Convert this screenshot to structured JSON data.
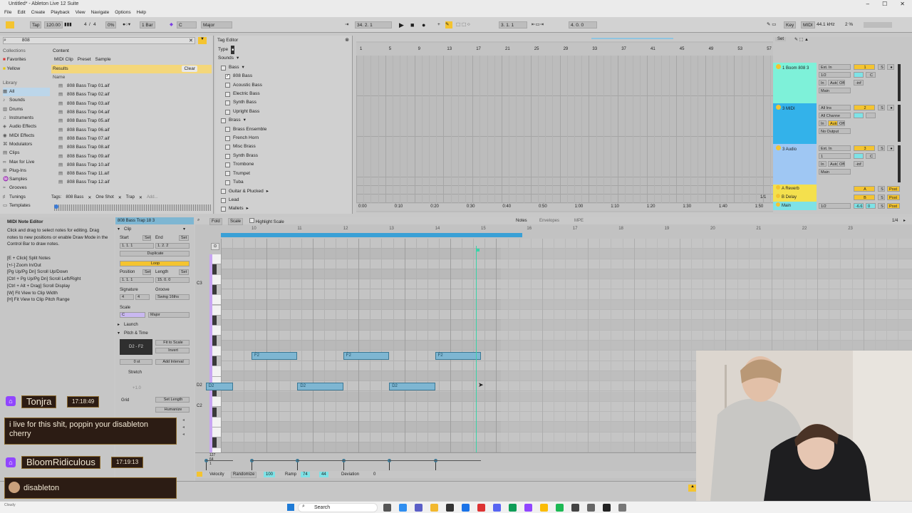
{
  "window": {
    "title": "Untitled* - Ableton Live 12 Suite"
  },
  "menu": [
    "File",
    "Edit",
    "Create",
    "Playback",
    "View",
    "Navigate",
    "Options",
    "Help"
  ],
  "control_bar": {
    "tap": "Tap",
    "tempo": "120.00",
    "meter_num": "4",
    "meter_den": "4",
    "swing": "0%",
    "quant": "1 Bar",
    "key": "C",
    "scale": "Major",
    "position": "34.  2.  1",
    "loop_start": "3.  1.  1",
    "loop_len": "4.  0.  0",
    "key_btn": "Key",
    "midi_btn": "MIDI",
    "sample_rate": "44.1 kHz",
    "cpu": "2 %"
  },
  "browser": {
    "search": "808",
    "collections_label": "Collections",
    "collections": [
      "Favorites",
      "Yellow"
    ],
    "library_label": "Library",
    "library": [
      "All",
      "Sounds",
      "Drums",
      "Instruments",
      "Audio Effects",
      "MIDI Effects",
      "Modulators",
      "Clips",
      "Max for Live",
      "Plug-Ins",
      "Samples",
      "Grooves",
      "Tunings",
      "Templates"
    ],
    "content_label": "Content",
    "content_filters": [
      "MIDI Clip",
      "Preset",
      "Sample"
    ],
    "results_label": "Results",
    "clear": "Clear",
    "name_col": "Name",
    "files": [
      "808 Bass Trap 01.aif",
      "808 Bass Trap 02.aif",
      "808 Bass Trap 03.aif",
      "808 Bass Trap 04.aif",
      "808 Bass Trap 05.aif",
      "808 Bass Trap 06.aif",
      "808 Bass Trap 07.aif",
      "808 Bass Trap 08.aif",
      "808 Bass Trap 09.aif",
      "808 Bass Trap 10.aif",
      "808 Bass Trap 11.aif",
      "808 Bass Trap 12.aif"
    ],
    "tags_label": "Tags:",
    "tags": [
      "808 Bass",
      "One Shot",
      "Trap",
      "Add..."
    ]
  },
  "tag_editor": {
    "title": "Tag Editor",
    "type_label": "Type",
    "sounds_label": "Sounds",
    "bass_label": "Bass",
    "bass_items": [
      {
        "label": "808 Bass",
        "checked": true
      },
      {
        "label": "Acoustic Bass",
        "checked": false
      },
      {
        "label": "Electric Bass",
        "checked": false
      },
      {
        "label": "Synth Bass",
        "checked": false
      },
      {
        "label": "Upright Bass",
        "checked": false
      }
    ],
    "brass_label": "Brass",
    "brass_items": [
      "Brass Ensemble",
      "French Horn",
      "Misc Brass",
      "Synth Brass",
      "Trombone",
      "Trumpet",
      "Tuba"
    ],
    "more": [
      "Guitar & Plucked",
      "Lead",
      "Mallets"
    ]
  },
  "arrangement": {
    "bars": [
      "1",
      "5",
      "9",
      "13",
      "17",
      "21",
      "25",
      "29",
      "33",
      "37",
      "41",
      "45",
      "49",
      "53",
      "57"
    ],
    "times": [
      "0:00",
      "0:10",
      "0:20",
      "0:30",
      "0:40",
      "0:50",
      "1:00",
      "1:10",
      "1:20",
      "1:30",
      "1:40",
      "1:50"
    ],
    "set_label": "Set",
    "fraction": "1/1"
  },
  "tracks": [
    {
      "name": "1 Boom 808 3",
      "color": "#7ef1d9",
      "input": "Ext. In",
      "channel": "1/2",
      "mon": [
        "In",
        "Auto",
        "Off"
      ],
      "out": "Main",
      "num": "1",
      "vol": "-inf",
      "pan": "C"
    },
    {
      "name": "3 MIDI",
      "color": "#33b2ea",
      "input": "All Ins",
      "channel": "All Channe",
      "mon": [
        "In",
        "Auto",
        "Off"
      ],
      "out": "No Output",
      "num": "2",
      "vol": "",
      "pan": ""
    },
    {
      "name": "3 Audio",
      "color": "#9fc7f3",
      "input": "Ext. In",
      "channel": "1",
      "mon": [
        "In",
        "Auto",
        "Off"
      ],
      "out": "Main",
      "num": "3",
      "vol": "-inf",
      "pan": "C"
    }
  ],
  "returns": [
    {
      "name": "A Reverb",
      "letter": "A",
      "post": "Post"
    },
    {
      "name": "B Delay",
      "letter": "B",
      "post": "Post"
    },
    {
      "name": "Main",
      "letter": "",
      "post": "Post",
      "ch": "1/2",
      "vol": "-6.6",
      "pan": "0"
    }
  ],
  "info_view": {
    "title": "MIDI Note Editor",
    "desc": "Click and drag to select notes for editing. Drag notes to new positions or enable Draw Mode in the Control Bar to draw notes.",
    "shortcuts": [
      "[E + Click] Split Notes",
      "[+/-] Zoom In/Out",
      "[Pg Up/Pg Dn] Scroll Up/Down",
      "[Ctrl + Pg Up/Pg Dn] Scroll Left/Right",
      "[Ctrl + Alt + Drag] Scroll Display",
      "[W] Fit View to Clip Width",
      "[H] Fit View to Clip Pitch Range"
    ]
  },
  "clip": {
    "name": "808 Bass Trap 18 3",
    "clip_label": "Clip",
    "start_label": "Start",
    "end_label": "End",
    "set": "Set",
    "start": "1.  1.  1",
    "end": "1.  2.  2",
    "duplicate": "Duplicate",
    "loop": "Loop",
    "position_label": "Position",
    "length_label": "Length",
    "position": "1.  1.  1",
    "length": "15.  0.  0",
    "signature_label": "Signature",
    "groove_label": "Groove",
    "sig_num": "4",
    "sig_den": "4",
    "groove": "Swing 16ths",
    "scale_label": "Scale",
    "scale_key": "C",
    "scale_name": "Major",
    "launch": "Launch",
    "pitch_time": "Pitch & Time",
    "range": "D2 - F2",
    "fit_scale": "Fit to Scale",
    "invert": "Invert",
    "transpose": "0 st",
    "add_interval": "Add Interval",
    "stretch": "Stretch",
    "stretch_val": "+1.0",
    "grid": "Grid",
    "set_length": "Set Length",
    "humanize": "Humanize"
  },
  "piano_roll": {
    "tabs": [
      "Notes",
      "Envelopes",
      "MPE"
    ],
    "tools": [
      "Fold",
      "Scale",
      "Highlight Scale"
    ],
    "bars": [
      "10",
      "11",
      "12",
      "13",
      "14",
      "15",
      "16",
      "17",
      "18",
      "19",
      "20",
      "21",
      "22",
      "23"
    ],
    "key_labels": [
      "C3",
      "D2",
      "C2"
    ],
    "fraction": "1/4",
    "notes": [
      {
        "pitch": "F2",
        "start": 10.0,
        "len": 1.0
      },
      {
        "pitch": "F2",
        "start": 12.0,
        "len": 1.0
      },
      {
        "pitch": "F2",
        "start": 14.0,
        "len": 1.0
      },
      {
        "pitch": "D2",
        "start": 9.0,
        "len": 0.6
      },
      {
        "pitch": "D2",
        "start": 11.0,
        "len": 1.0
      },
      {
        "pitch": "D2",
        "start": 13.0,
        "len": 1.0
      }
    ],
    "velocity_scale": [
      "127",
      "64",
      "1"
    ],
    "velocity_bar": {
      "velocity": "Velocity",
      "randomize": "Randomize",
      "rand_val": "100",
      "ramp": "Ramp",
      "ramp_a": "74",
      "ramp_b": "44",
      "deviation": "Deviation",
      "dev_val": "0"
    }
  },
  "chat": [
    {
      "user": "Tonjra",
      "time": "17:18:49",
      "msg": "i live for this shit, poppin your disableton cherry"
    },
    {
      "user": "BloomRidiculous",
      "time": "17:19:13",
      "msg": "disableton"
    }
  ],
  "taskbar": {
    "search": "Search",
    "weather": "Cloudy"
  },
  "colors": {
    "accent": "#f4c430",
    "clip": "#7eb6d2",
    "track1": "#7ef1d9",
    "track2": "#33b2ea",
    "track3": "#9fc7f3",
    "return": "#f4c430"
  }
}
